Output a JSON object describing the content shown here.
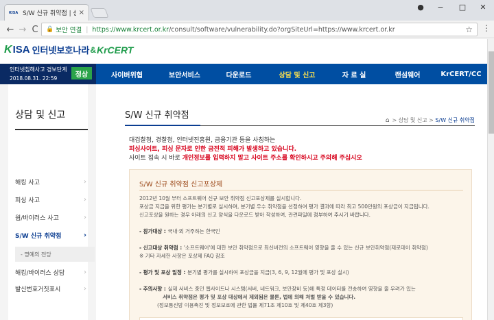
{
  "browser": {
    "tab_favicon": "KISA",
    "tab_title": "S/W 신규 취약점 | 상담",
    "tab_close": "×",
    "win_user": "●",
    "win_min": "−",
    "win_max": "□",
    "win_close": "✕",
    "back": "←",
    "forward": "→",
    "reload": "C",
    "lock": "🔒",
    "secure_label": "보안 연결",
    "url_scheme": "https://www.krcert.or.kr",
    "url_rest": "/consult/software/vulnerability.do?orgSiteUrl=https://www.krcert.or.kr",
    "star": "☆",
    "menu": "⋮"
  },
  "site": {
    "logo": {
      "mark": "K",
      "kisa": "ISA",
      "korean": "인터넷보호나라",
      "amp": "&",
      "krcert": "KrCERT"
    },
    "alert": {
      "title": "인터넷침해사고 경보단계",
      "date": "2018.08.31. 22:59",
      "level": "정상"
    },
    "menu": [
      "사이버위협",
      "보안서비스",
      "다운로드",
      "상담 및 신고",
      "자 료 실",
      "랜섬웨어",
      "KrCERT/CC"
    ],
    "lnb": {
      "title": "상담 및 신고",
      "items": [
        "해킹 사고",
        "피싱 사고",
        "웜/바이러스 사고",
        "S/W 신규 취약점",
        "해킹/바이러스 상담",
        "발신번호거짓표시"
      ],
      "arrow": "›",
      "sub": "- 명예의 전당"
    },
    "content": {
      "title": "S/W 신규 취약점",
      "crumb_home": "⌂",
      "crumb": [
        "상담 및 신고",
        "S/W 신규 취약점"
      ],
      "crumb_sep": ">",
      "notice_1": "대검찰청, 경찰청, 인터넷진흥원, 금융기관 등을 사칭하는",
      "notice_2": "피싱사이트, 피싱 문자로 인한 금전적 피해가 발생하고 있습니다.",
      "notice_3a": "사이트 접속 시 바로 ",
      "notice_3b": "개인정보를 입력하지 말고 사이트 주소를 확인하시고 주의해 주십시오",
      "box_title": "S/W 신규 취약점 신고포상제",
      "box_lines": {
        "l1": "2012년 10월 부터 소프트웨어 신규 보안 취약점 신고포상제를 실시합니다.",
        "l2": "포상금 지급을 위한 평가는 분기별로 실시하며, 분기별 우수 취약점을 선정하여 평가 결과에 따라 최고 500만원의 포상금이 지급됩니다.",
        "l3": "신고포상을 원하는 경우 아래의 신고 양식을 다운로드 받아 작성하여, 관련파일에 첨부하여 주시기 바랍니다.",
        "t1_label": "- 참가대상 : ",
        "t1_text": "국내·외 거주하는 한국인",
        "t2_label": "- 신고대상 취약점 : ",
        "t2_text": "'소프트웨어'에 대한 보안 취약점으로 최신버전의 소프트웨어 영향을 줄 수 있는 신규 보안취약점(제로데이 취약점)",
        "t2_note": "※ 기타 자세한 사항은 포상제 FAQ 참조",
        "t3_label": "- 평가 및 포상 일정 : ",
        "t3_text": "분기별 평가를 실시하여 포상금을 지급(3, 6, 9, 12월에 평가 및 포상 실시)",
        "t4_label": "- 주의사항 : ",
        "t4_text": "실제 서비스 중인 웹사이트나 시스템(서버, 네트워크, 보안장비 등)에 특정 데이터를 전송하여 영향을 줄 우려가 있는",
        "t4_red": "서비스 취약점은 평가 및 포상 대상에서 제외됨은 물론, 법에 의해 처벌 받을 수 있습니다.",
        "t4_note": "(정보통신망 이용촉진 및 정보보호에 관한 법률 제71조 제10호 및 제40호 제3항)"
      }
    }
  }
}
